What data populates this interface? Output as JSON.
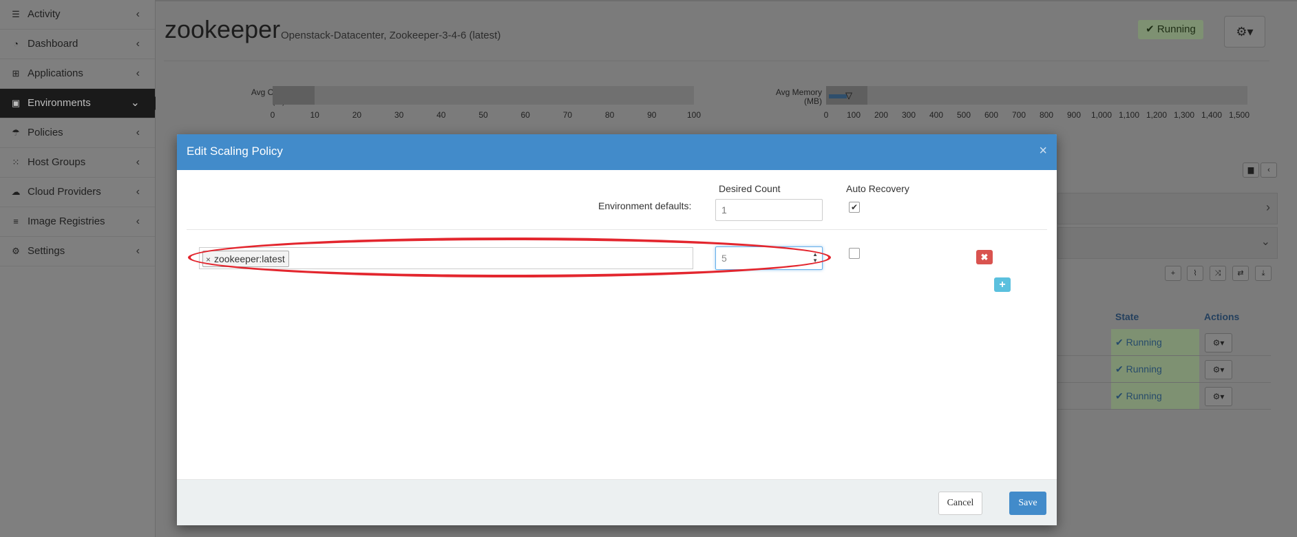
{
  "sidebar": {
    "items": [
      {
        "label": "Activity",
        "icon": "list-icon",
        "glyph": "☰"
      },
      {
        "label": "Dashboard",
        "icon": "tachometer-icon",
        "glyph": "◔"
      },
      {
        "label": "Applications",
        "icon": "sitemap-icon",
        "glyph": "⊞"
      },
      {
        "label": "Environments",
        "icon": "image-icon",
        "glyph": "▣",
        "active": true
      },
      {
        "label": "Policies",
        "icon": "umbrella-icon",
        "glyph": "☂"
      },
      {
        "label": "Host Groups",
        "icon": "th-icon",
        "glyph": "⁙"
      },
      {
        "label": "Cloud Providers",
        "icon": "cloud-icon",
        "glyph": "☁"
      },
      {
        "label": "Image Registries",
        "icon": "database-icon",
        "glyph": "≡"
      },
      {
        "label": "Settings",
        "icon": "gear-icon",
        "glyph": "⚙"
      }
    ]
  },
  "header": {
    "title": "zookeeper",
    "subtitle": "Openstack-Datacenter, Zookeeper-3-4-6 (latest)",
    "status": "Running"
  },
  "cpu_meter": {
    "label_line1": "Avg CPU",
    "label_line2": "(%)",
    "ticks": [
      "0",
      "10",
      "20",
      "30",
      "40",
      "50",
      "60",
      "70",
      "80",
      "90",
      "100"
    ],
    "value_percent": 10
  },
  "memory_meter": {
    "label_line1": "Avg Memory",
    "label_line2": "(MB)",
    "ticks": [
      "0",
      "100",
      "200",
      "300",
      "400",
      "500",
      "600",
      "700",
      "800",
      "900",
      "1,000",
      "1,100",
      "1,200",
      "1,300",
      "1,400",
      "1,500"
    ],
    "value_mb": 150
  },
  "background_table": {
    "headers": {
      "state": "State",
      "actions": "Actions"
    },
    "rows": [
      {
        "state": "Running"
      },
      {
        "state": "Running"
      },
      {
        "state": "Running"
      }
    ]
  },
  "modal": {
    "title": "Edit Scaling Policy",
    "close": "×",
    "col_desired_count": "Desired Count",
    "col_auto_recovery": "Auto Recovery",
    "env_defaults_label": "Environment defaults:",
    "env_defaults_count": "1",
    "env_defaults_auto_recovery": true,
    "rule": {
      "tag": "zookeeper:latest",
      "count": "5",
      "auto_recovery": false
    },
    "cancel_label": "Cancel",
    "save_label": "Save"
  },
  "colors": {
    "modal_header": "#428bca",
    "delete_button": "#d9534f",
    "add_button": "#5bc0de",
    "highlight": "#e3262e",
    "status_running": "#7e9172"
  }
}
